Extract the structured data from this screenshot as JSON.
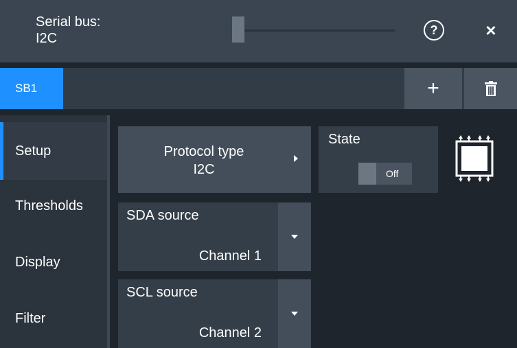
{
  "header": {
    "title_line1": "Serial bus:",
    "title_line2": "I2C",
    "help_icon": "?",
    "close_icon": "×"
  },
  "tabs": {
    "active_label": "SB1",
    "add_icon": "+",
    "delete_icon": "trash-icon"
  },
  "sidebar": {
    "items": [
      {
        "label": "Setup",
        "active": true
      },
      {
        "label": "Thresholds",
        "active": false
      },
      {
        "label": "Display",
        "active": false
      },
      {
        "label": "Filter",
        "active": false
      }
    ]
  },
  "setup": {
    "protocol": {
      "label": "Protocol type",
      "value": "I2C"
    },
    "state": {
      "label": "State",
      "value": "Off"
    },
    "sda": {
      "label": "SDA source",
      "value": "Channel 1"
    },
    "scl": {
      "label": "SCL source",
      "value": "Channel 2"
    }
  },
  "colors": {
    "accent": "#1e90ff",
    "header_bg": "#3a4551",
    "panel_bg": "#343e48"
  }
}
